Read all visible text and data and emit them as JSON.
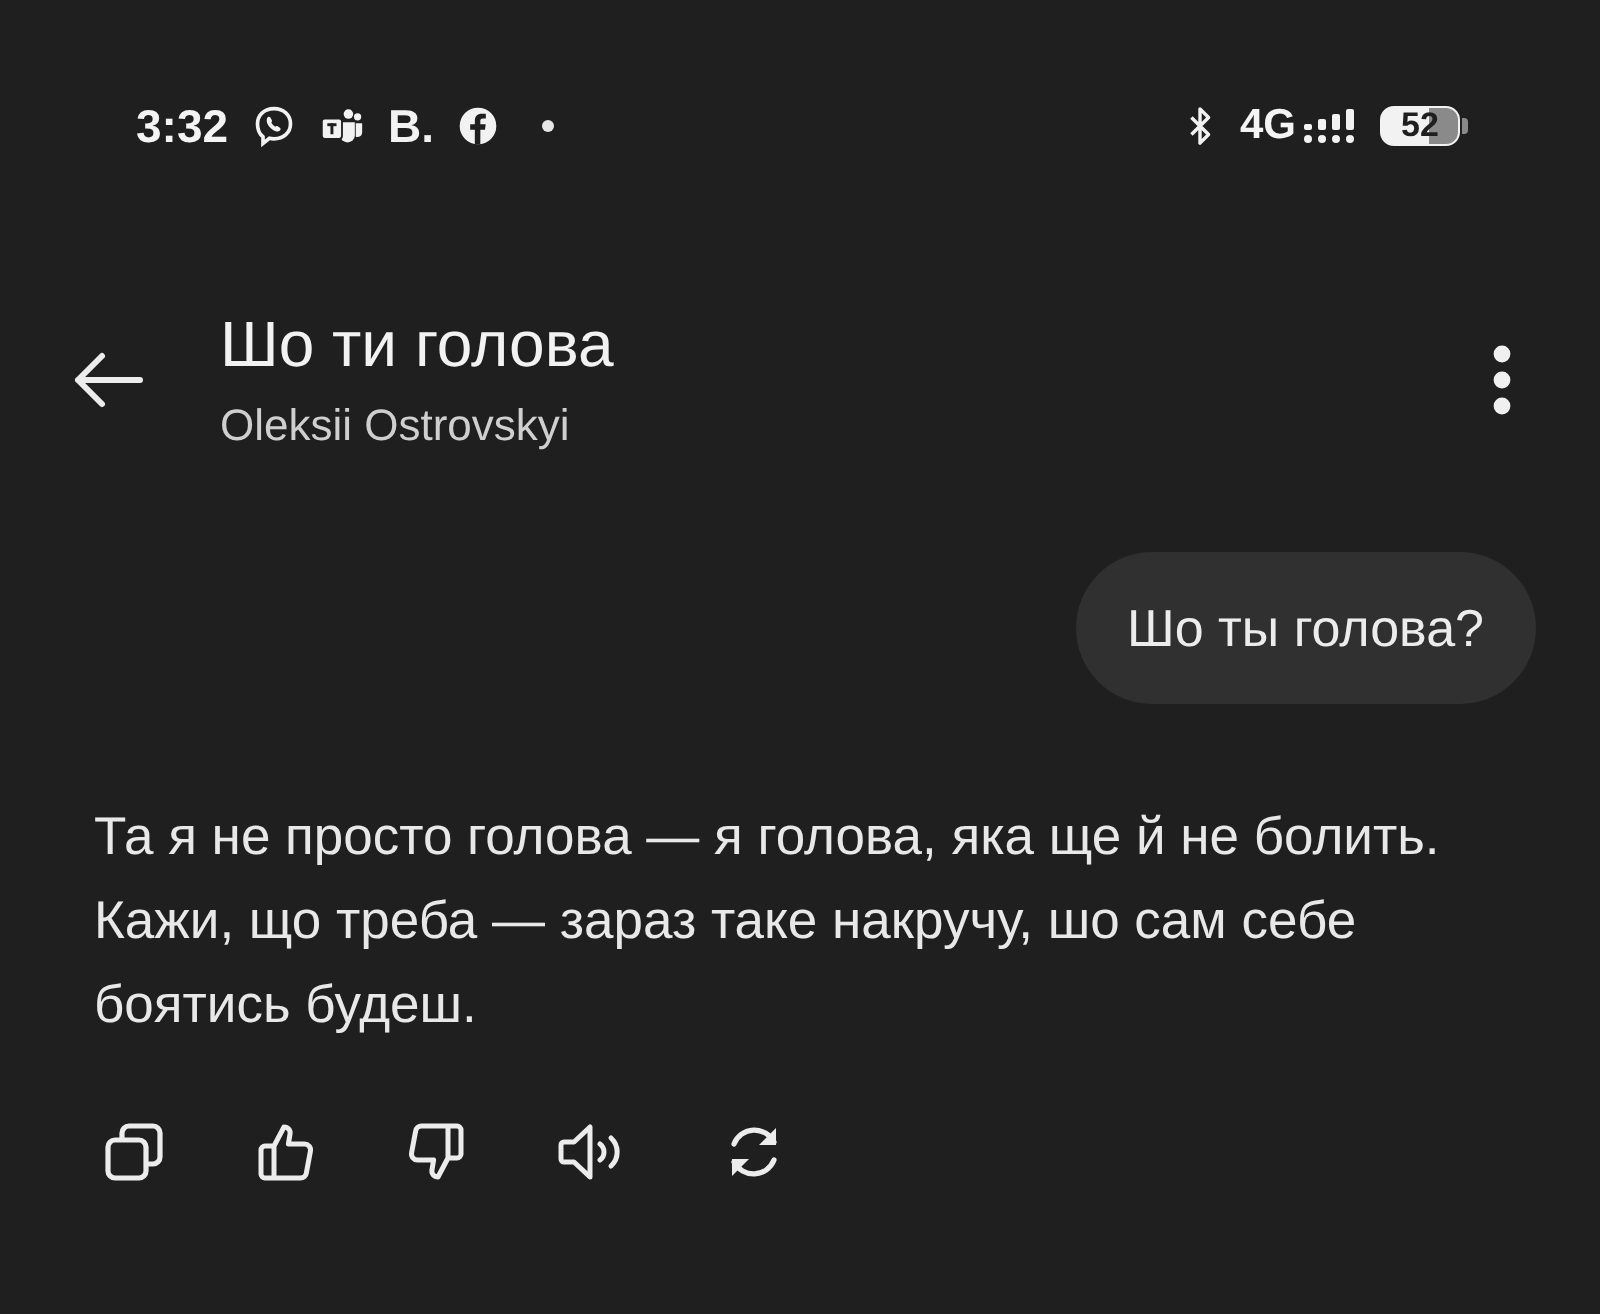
{
  "status_bar": {
    "time": "3:32",
    "notification_text": "B.",
    "network": "4G",
    "battery": "52"
  },
  "header": {
    "title": "Шо ти голова",
    "subtitle": "Oleksii Ostrovskyi"
  },
  "messages": [
    {
      "kind": "user",
      "text": "Шо ты голова?"
    },
    {
      "kind": "assistant",
      "text": "Та я не просто голова — я голова, яка ще й не болить. Кажи, що треба — зараз таке накручу, шо сам себе боятись будеш."
    }
  ]
}
